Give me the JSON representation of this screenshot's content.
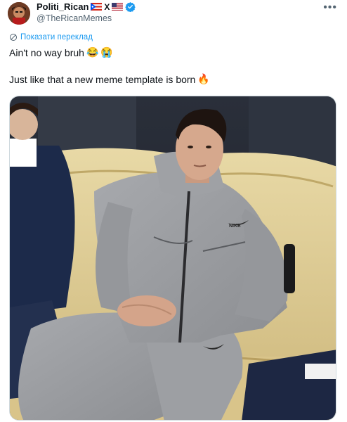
{
  "author": {
    "display_name": "Politi_Rican",
    "handle": "@TheRicanMemes",
    "x_mark": "X",
    "verified": true
  },
  "menu": {
    "more_label": "•••"
  },
  "tweet": {
    "translate_label": "Показати переклад",
    "line1": "Ain't no way bruh",
    "line2": "Just like that a new meme template is born"
  },
  "icons": {
    "laugh_cry": "😂",
    "sob": "😭",
    "fire": "🔥",
    "verified": "verified-badge-icon",
    "translate": "translate-icon"
  },
  "media": {
    "sweatshirt_logo": "NIKE",
    "accent_color": "#1d9bf0"
  }
}
